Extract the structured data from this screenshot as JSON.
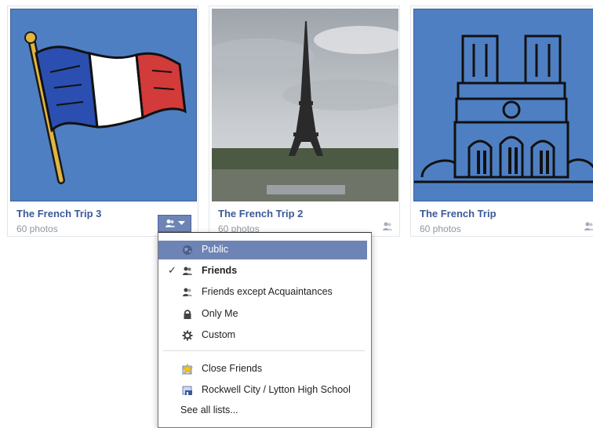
{
  "albums": [
    {
      "title": "The French Trip 3",
      "count": "60 photos",
      "image": "french-flag"
    },
    {
      "title": "The French Trip 2",
      "count": "60 photos",
      "image": "eiffel-tower-photo"
    },
    {
      "title": "The French Trip",
      "count": "60 photos",
      "image": "notre-dame"
    }
  ],
  "privacy_menu": {
    "selected": "Friends",
    "items": [
      {
        "label": "Public",
        "icon": "globe-icon",
        "highlighted": true
      },
      {
        "label": "Friends",
        "icon": "friends-icon",
        "checked": true
      },
      {
        "label": "Friends except Acquaintances",
        "icon": "friends-except-icon"
      },
      {
        "label": "Only Me",
        "icon": "lock-icon"
      },
      {
        "label": "Custom",
        "icon": "gear-icon"
      }
    ],
    "lists": [
      {
        "label": "Close Friends",
        "icon": "star-list-icon"
      },
      {
        "label": "Rockwell City / Lytton High School",
        "icon": "school-list-icon"
      }
    ],
    "see_all": "See all lists..."
  },
  "colors": {
    "link": "#3b5998",
    "highlight": "#6d84b4",
    "clipart_blue": "#4f7fc3"
  }
}
